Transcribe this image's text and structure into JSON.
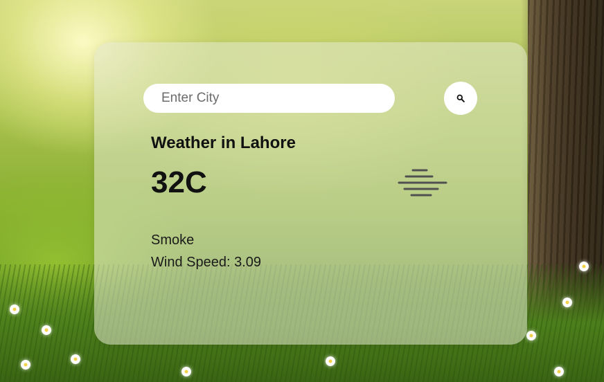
{
  "search": {
    "placeholder": "Enter City",
    "value": "",
    "button_icon": "search-icon"
  },
  "weather": {
    "title": "Weather in Lahore",
    "temperature": "32C",
    "condition_icon": "haze-icon",
    "description": "Smoke",
    "wind_speed": "Wind Speed: 3.09"
  },
  "colors": {
    "card_background": "#e1e8cd",
    "text": "#111111",
    "icon": "#555555",
    "input_background": "#ffffff"
  }
}
